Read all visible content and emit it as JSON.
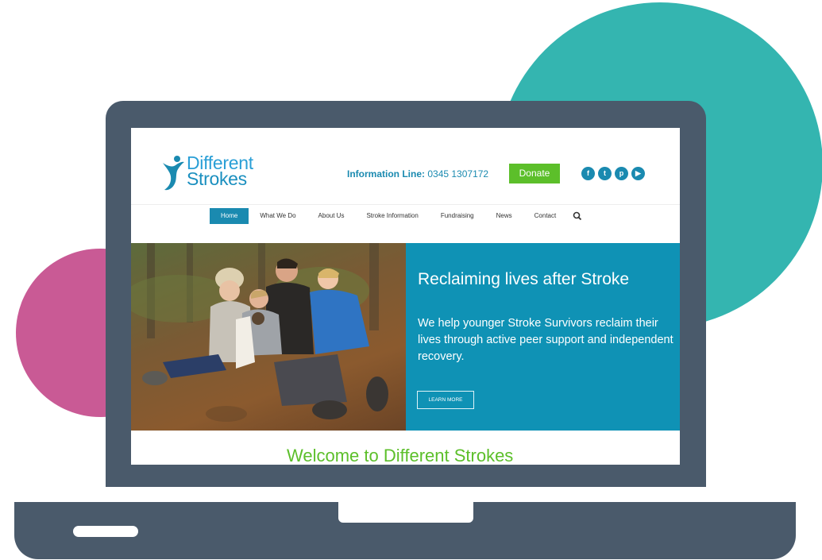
{
  "site": {
    "logo": {
      "line1": "Different",
      "line2": "Strokes"
    },
    "info_line": {
      "label": "Information Line:",
      "number": "0345 1307172"
    },
    "donate_label": "Donate",
    "socials": [
      {
        "icon": "facebook-icon",
        "glyph": "f"
      },
      {
        "icon": "twitter-icon",
        "glyph": "t"
      },
      {
        "icon": "pinterest-icon",
        "glyph": "p"
      },
      {
        "icon": "youtube-icon",
        "glyph": "▶"
      }
    ],
    "nav": {
      "items": [
        "Home",
        "What We Do",
        "About Us",
        "Stroke Information",
        "Fundraising",
        "News",
        "Contact"
      ],
      "active": "Home"
    },
    "hero": {
      "title": "Reclaiming lives after Stroke",
      "text": "We help younger Stroke Survivors reclaim their lives through active peer support and independent recovery.",
      "cta": "LEARN MORE"
    },
    "welcome_heading": "Welcome to Different Strokes"
  },
  "colors": {
    "brand_blue": "#1a8ab0",
    "hero_blue": "#0f92b5",
    "donate_green": "#5cbf2a",
    "laptop_gray": "#4a5a6b",
    "teal_circle": "#34b5b0",
    "pink_circle": "#c95a95"
  }
}
